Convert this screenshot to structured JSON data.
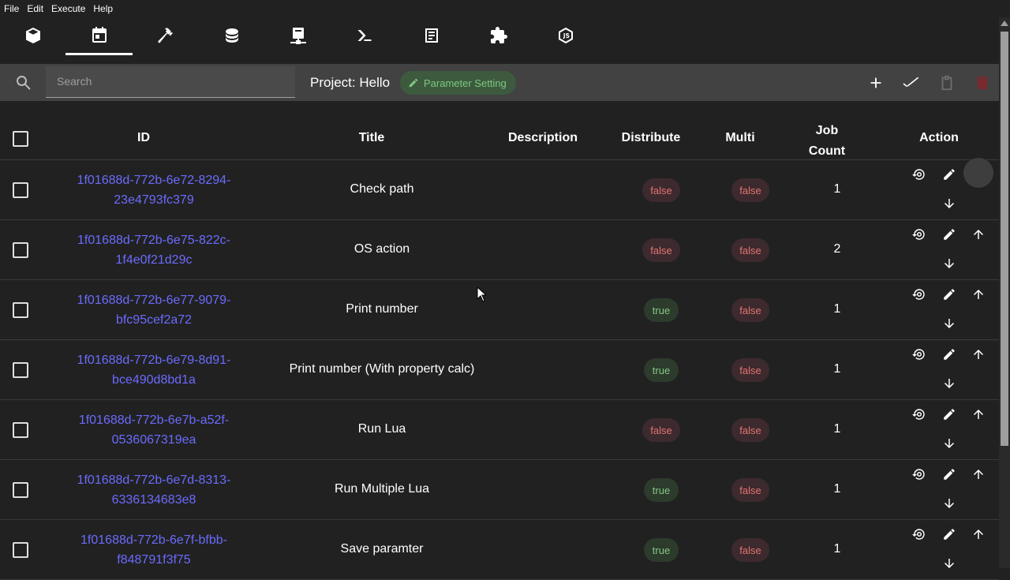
{
  "menu": [
    "File",
    "Edit",
    "Execute",
    "Help"
  ],
  "toolbar_icons": [
    "package-icon",
    "calendar-icon",
    "hammer-icon",
    "database-icon",
    "server-network-icon",
    "console-icon",
    "note-icon",
    "puzzle-icon",
    "nodejs-icon"
  ],
  "search": {
    "placeholder": "Search"
  },
  "project_label": "Project: Hello",
  "param_chip": "Parameter Setting",
  "headers": {
    "id": "ID",
    "title": "Title",
    "description": "Description",
    "distribute": "Distribute",
    "multi": "Multi",
    "job_count_line1": "Job",
    "job_count_line2": "Count",
    "action": "Action"
  },
  "rows": [
    {
      "id1": "1f01688d-772b-6e72-8294-",
      "id2": "23e4793fc379",
      "title": "Check path",
      "distribute": "false",
      "multi": "false",
      "count": "1"
    },
    {
      "id1": "1f01688d-772b-6e75-822c-",
      "id2": "1f4e0f21d29c",
      "title": "OS action",
      "distribute": "false",
      "multi": "false",
      "count": "2"
    },
    {
      "id1": "1f01688d-772b-6e77-9079-",
      "id2": "bfc95cef2a72",
      "title": "Print number",
      "distribute": "true",
      "multi": "false",
      "count": "1"
    },
    {
      "id1": "1f01688d-772b-6e79-8d91-",
      "id2": "bce490d8bd1a",
      "title": "Print number (With property calc)",
      "distribute": "true",
      "multi": "false",
      "count": "1"
    },
    {
      "id1": "1f01688d-772b-6e7b-a52f-",
      "id2": "0536067319ea",
      "title": "Run Lua",
      "distribute": "false",
      "multi": "false",
      "count": "1"
    },
    {
      "id1": "1f01688d-772b-6e7d-8313-",
      "id2": "6336134683e8",
      "title": "Run Multiple Lua",
      "distribute": "true",
      "multi": "false",
      "count": "1"
    },
    {
      "id1": "1f01688d-772b-6e7f-bfbb-",
      "id2": "f848791f3f75",
      "title": "Save paramter",
      "distribute": "true",
      "multi": "false",
      "count": "1"
    }
  ]
}
